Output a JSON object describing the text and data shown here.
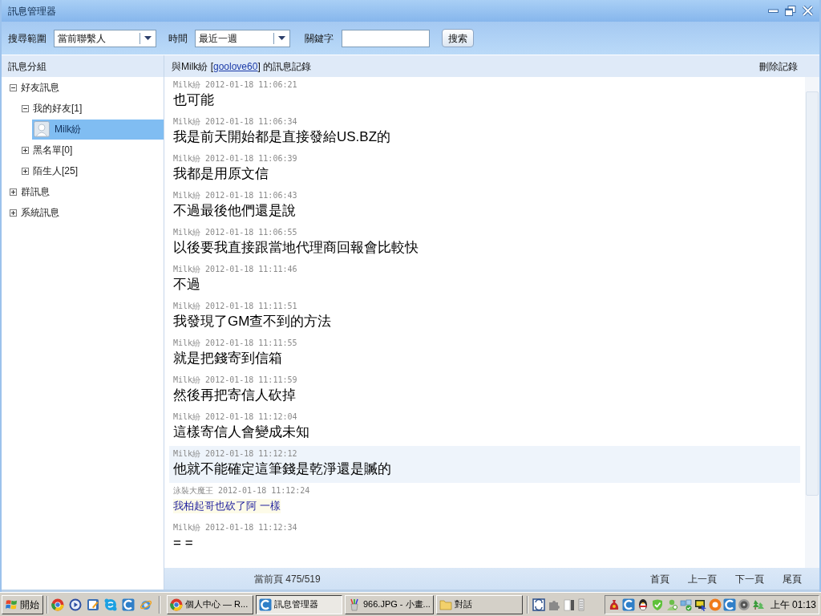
{
  "window": {
    "title": "訊息管理器"
  },
  "toolbar": {
    "scope_label": "搜尋範圍",
    "scope_value": "當前聯繫人",
    "time_label": "時間",
    "time_value": "最近一週",
    "keyword_label": "關鍵字",
    "search_button": "搜索"
  },
  "sidebar": {
    "title": "訊息分組",
    "tree": [
      {
        "label": "好友訊息",
        "kind": "group",
        "expanded": true,
        "selected": false,
        "children": [
          {
            "label": "我的好友[1]",
            "kind": "group",
            "expanded": true,
            "selected": false,
            "children": [
              {
                "label": "Milk紛",
                "kind": "contact",
                "selected": true
              }
            ]
          },
          {
            "label": "黑名單[0]",
            "kind": "group",
            "expanded": false,
            "selected": false
          },
          {
            "label": "陌生人[25]",
            "kind": "group",
            "expanded": false,
            "selected": false
          }
        ]
      },
      {
        "label": "群訊息",
        "kind": "group",
        "expanded": false,
        "selected": false
      },
      {
        "label": "系統訊息",
        "kind": "group",
        "expanded": false,
        "selected": false
      }
    ]
  },
  "record_header": {
    "prefix": "與Milk紛 [",
    "link": "goolove60",
    "suffix": "] 的訊息記錄",
    "delete_button": "刪除記錄"
  },
  "messages": [
    {
      "sender": "Milk紛",
      "time": "2012-01-18 11:06:21",
      "text": "也可能",
      "kind": "contact",
      "highlighted": false
    },
    {
      "sender": "Milk紛",
      "time": "2012-01-18 11:06:34",
      "text": "我是前天開始都是直接發給US.BZ的",
      "kind": "contact",
      "highlighted": false
    },
    {
      "sender": "Milk紛",
      "time": "2012-01-18 11:06:39",
      "text": "我都是用原文信",
      "kind": "contact",
      "highlighted": false
    },
    {
      "sender": "Milk紛",
      "time": "2012-01-18 11:06:43",
      "text": "不過最後他們還是說",
      "kind": "contact",
      "highlighted": false
    },
    {
      "sender": "Milk紛",
      "time": "2012-01-18 11:06:55",
      "text": "以後要我直接跟當地代理商回報會比較快",
      "kind": "contact",
      "highlighted": false
    },
    {
      "sender": "Milk紛",
      "time": "2012-01-18 11:11:46",
      "text": "不過",
      "kind": "contact",
      "highlighted": false
    },
    {
      "sender": "Milk紛",
      "time": "2012-01-18 11:11:51",
      "text": "我發現了GM查不到的方法",
      "kind": "contact",
      "highlighted": false
    },
    {
      "sender": "Milk紛",
      "time": "2012-01-18 11:11:55",
      "text": "就是把錢寄到信箱",
      "kind": "contact",
      "highlighted": false
    },
    {
      "sender": "Milk紛",
      "time": "2012-01-18 11:11:59",
      "text": "然後再把寄信人砍掉",
      "kind": "contact",
      "highlighted": false
    },
    {
      "sender": "Milk紛",
      "time": "2012-01-18 11:12:04",
      "text": "這樣寄信人會變成未知",
      "kind": "contact",
      "highlighted": false
    },
    {
      "sender": "Milk紛",
      "time": "2012-01-18 11:12:12",
      "text": "他就不能確定這筆錢是乾淨還是贓的",
      "kind": "contact",
      "highlighted": true
    },
    {
      "sender": "泳裝大魔王",
      "time": "2012-01-18 11:12:24",
      "text": "我柏起哥也砍了阿 一樣",
      "kind": "self",
      "highlighted": false
    },
    {
      "sender": "Milk紛",
      "time": "2012-01-18 11:12:34",
      "text": "= =",
      "kind": "contact",
      "highlighted": false
    }
  ],
  "pager": {
    "current": "當前頁 475/519",
    "links": [
      "首頁",
      "上一頁",
      "下一頁",
      "尾頁"
    ]
  },
  "taskbar": {
    "start": "開始",
    "tasks": [
      {
        "label": "個人中心 — R...",
        "selected": false
      },
      {
        "label": "訊息管理器",
        "selected": true
      },
      {
        "label": "966.JPG - 小畫...",
        "selected": false
      },
      {
        "label": "對話",
        "selected": false
      }
    ],
    "clock": "上午 01:13"
  }
}
